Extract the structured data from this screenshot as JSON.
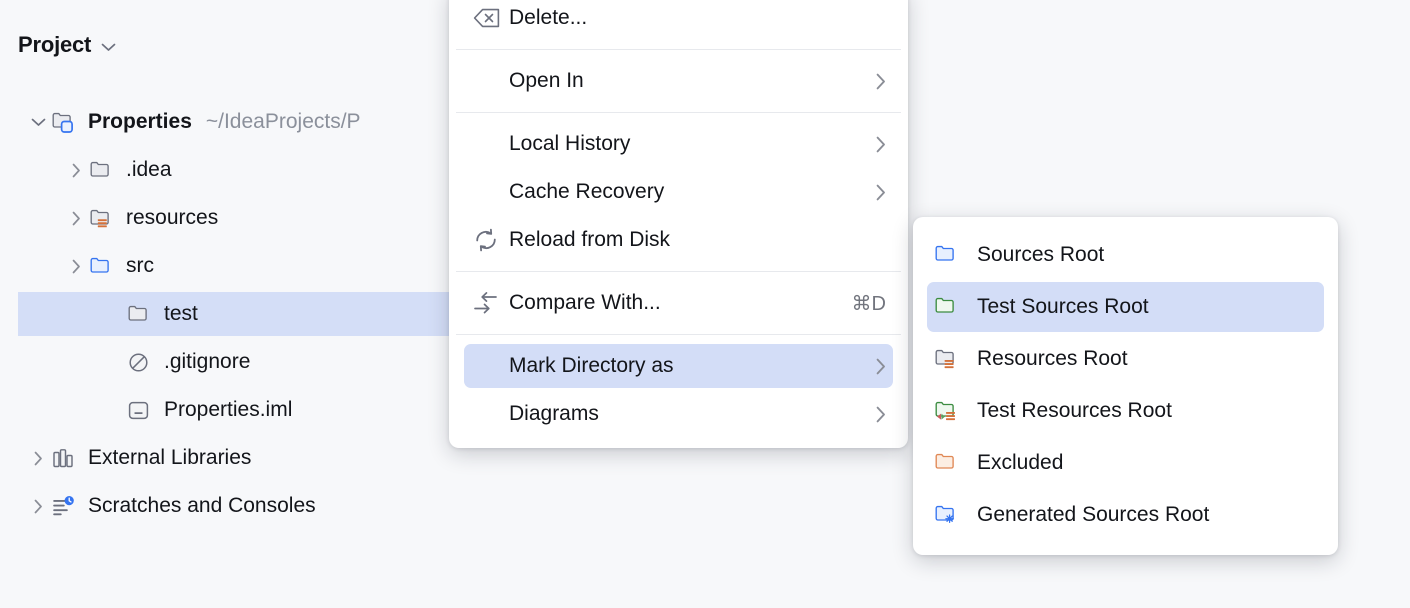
{
  "panel": {
    "title": "Project",
    "dropdown_icon": "chevron-down-icon"
  },
  "tree": {
    "nodes": [
      {
        "label": "Properties",
        "secondary": "~/IdeaProjects/P",
        "icon": "project-folder-icon",
        "arrow": "chevron-down-icon",
        "level": 0,
        "bold": true,
        "selected": false
      },
      {
        "label": ".idea",
        "secondary": "",
        "icon": "folder-icon",
        "arrow": "chevron-right-icon",
        "level": 1,
        "bold": false,
        "selected": false
      },
      {
        "label": "resources",
        "secondary": "",
        "icon": "resources-folder-icon",
        "arrow": "chevron-right-icon",
        "level": 1,
        "bold": false,
        "selected": false
      },
      {
        "label": "src",
        "secondary": "",
        "icon": "sources-folder-icon",
        "arrow": "chevron-right-icon",
        "level": 1,
        "bold": false,
        "selected": false
      },
      {
        "label": "test",
        "secondary": "",
        "icon": "folder-icon",
        "arrow": "",
        "level": 2,
        "bold": false,
        "selected": true
      },
      {
        "label": ".gitignore",
        "secondary": "",
        "icon": "gitignore-icon",
        "arrow": "",
        "level": 2,
        "bold": false,
        "selected": false
      },
      {
        "label": "Properties.iml",
        "secondary": "",
        "icon": "iml-file-icon",
        "arrow": "",
        "level": 2,
        "bold": false,
        "selected": false
      },
      {
        "label": "External Libraries",
        "secondary": "",
        "icon": "libraries-icon",
        "arrow": "chevron-right-icon",
        "level": 0,
        "bold": false,
        "selected": false
      },
      {
        "label": "Scratches and Consoles",
        "secondary": "",
        "icon": "scratches-icon",
        "arrow": "chevron-right-icon",
        "level": 0,
        "bold": false,
        "selected": false
      }
    ]
  },
  "context_menu": {
    "items": [
      {
        "type": "item",
        "label": "Delete...",
        "icon": "delete-key-icon",
        "accel": "",
        "arrow": false,
        "highlight": false
      },
      {
        "type": "separator"
      },
      {
        "type": "item",
        "label": "Open In",
        "icon": "",
        "accel": "",
        "arrow": true,
        "highlight": false
      },
      {
        "type": "separator"
      },
      {
        "type": "item",
        "label": "Local History",
        "icon": "",
        "accel": "",
        "arrow": true,
        "highlight": false
      },
      {
        "type": "item",
        "label": "Cache Recovery",
        "icon": "",
        "accel": "",
        "arrow": true,
        "highlight": false
      },
      {
        "type": "item",
        "label": "Reload from Disk",
        "icon": "reload-icon",
        "accel": "",
        "arrow": false,
        "highlight": false
      },
      {
        "type": "separator"
      },
      {
        "type": "item",
        "label": "Compare With...",
        "icon": "compare-icon",
        "accel": "⌘D",
        "arrow": false,
        "highlight": false
      },
      {
        "type": "separator"
      },
      {
        "type": "item",
        "label": "Mark Directory as",
        "icon": "",
        "accel": "",
        "arrow": true,
        "highlight": true
      },
      {
        "type": "item",
        "label": "Diagrams",
        "icon": "",
        "accel": "",
        "arrow": true,
        "highlight": false
      }
    ]
  },
  "submenu": {
    "items": [
      {
        "label": "Sources Root",
        "icon": "sources-root-folder-icon",
        "highlight": false
      },
      {
        "label": "Test Sources Root",
        "icon": "test-sources-root-folder-icon",
        "highlight": true
      },
      {
        "label": "Resources Root",
        "icon": "resources-root-folder-icon",
        "highlight": false
      },
      {
        "label": "Test Resources Root",
        "icon": "test-resources-root-folder-icon",
        "highlight": false
      },
      {
        "label": "Excluded",
        "icon": "excluded-folder-icon",
        "highlight": false
      },
      {
        "label": "Generated Sources Root",
        "icon": "generated-sources-root-folder-icon",
        "highlight": false
      }
    ]
  },
  "colors": {
    "background": "#F7F8FA",
    "menu_background": "#FFFFFF",
    "selection": "#D4DEF7",
    "menu_highlight": "#D3DDF7",
    "text": "#13151A",
    "secondary_text": "#8B909B",
    "separator": "#E7E9ED",
    "accent_blue": "#3574F0",
    "accent_green": "#3C8C41",
    "accent_orange": "#E08855",
    "icon_gray": "#6C707E"
  }
}
